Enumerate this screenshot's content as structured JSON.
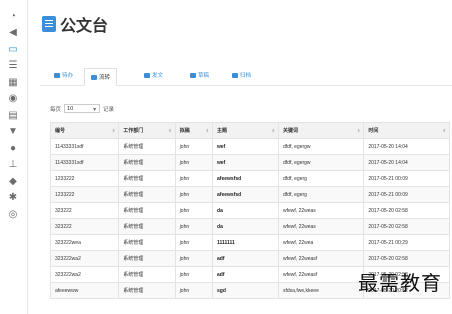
{
  "title": "公文台",
  "sidebar_icons": [
    "dashboard-icon",
    "megaphone-icon",
    "folder-icon",
    "list-icon",
    "calendar-icon",
    "target-icon",
    "monitor-icon",
    "filter-icon",
    "user-icon",
    "org-chart-icon",
    "chat-icon",
    "gear-icon",
    "globe-icon"
  ],
  "sidebar_active": 2,
  "tabs": [
    {
      "label": "待办"
    },
    {
      "label": "流转"
    },
    {
      "label": "发文"
    },
    {
      "label": "草稿"
    },
    {
      "label": "归档"
    }
  ],
  "active_tab": 1,
  "page_size": {
    "prefix": "每页",
    "value": "10",
    "suffix": "记录"
  },
  "columns": [
    "编号",
    "工作部门",
    "拟稿",
    "主题",
    "关键词",
    "时间"
  ],
  "rows": [
    [
      "11433331sdf",
      "系统管理",
      "john",
      "wef",
      "dfdf, egergw",
      "2017-05-20 14:04"
    ],
    [
      "11433331sdf",
      "系统管理",
      "john",
      "wef",
      "dfdf, egergw",
      "2017-05-20 14:04"
    ],
    [
      "1233222",
      "系统管理",
      "john",
      "afeewsfsd",
      "dfdf, egerg",
      "2017-05-21 00:09"
    ],
    [
      "1233222",
      "系统管理",
      "john",
      "afeewsfsd",
      "dfdf, egerg",
      "2017-05-21 00:09"
    ],
    [
      "323222",
      "系统管理",
      "john",
      "da",
      "wfewf, 22weas",
      "2017-05-20 02:58"
    ],
    [
      "323222",
      "系统管理",
      "john",
      "da",
      "wfewf, 22weas",
      "2017-05-20 02:58"
    ],
    [
      "323222wea",
      "系统管理",
      "john",
      "1111111",
      "wfewf, 22wea",
      "2017-05-21 00:29"
    ],
    [
      "323222wa2",
      "系统管理",
      "john",
      "adf",
      "wfewf, 22weasf",
      "2017-05-20 02:58"
    ],
    [
      "323222wa2",
      "系统管理",
      "john",
      "adf",
      "wfewf, 22weasf",
      "2017-05-20 02:58"
    ],
    [
      "afeeewww",
      "系统管理",
      "john",
      "sgd",
      "sfdsa,fwe,kkeee",
      "2017-05-20 20:52"
    ]
  ],
  "watermark": "最需教育"
}
